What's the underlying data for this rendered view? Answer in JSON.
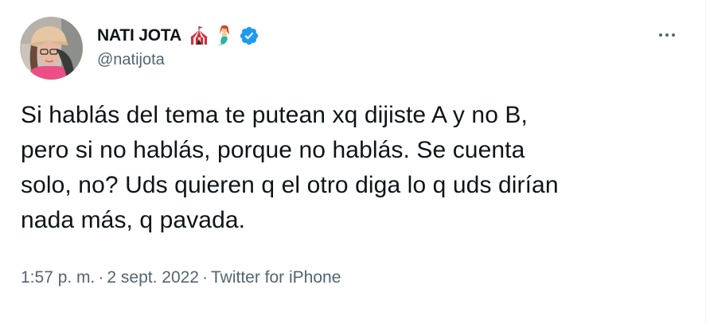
{
  "author": {
    "display_name": "NATI JOTA",
    "handle": "@natijota",
    "name_emojis": [
      "circus-tent",
      "mermaid"
    ],
    "verified": true,
    "avatar": "profile-photo"
  },
  "tweet": {
    "lines": [
      "Si hablás del tema te putean xq dijiste A y no B,",
      "pero si no hablás, porque no hablás. Se cuenta",
      "solo, no? Uds quieren q el otro diga lo q uds dirían",
      "nada más, q pavada."
    ],
    "time": "1:57 p. m.",
    "separator": "·",
    "date": "2 sept. 2022",
    "source": "Twitter for iPhone"
  },
  "icons": {
    "more": "more-horizontal-icon",
    "verified": "verified-badge-icon"
  },
  "colors": {
    "text_primary": "#0f1419",
    "text_secondary": "#536471",
    "verified_blue": "#1d9bf0"
  }
}
